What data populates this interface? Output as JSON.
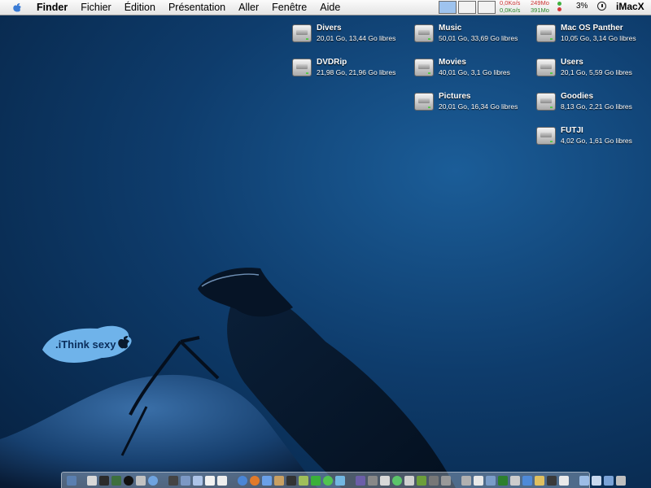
{
  "menubar": {
    "apple_icon": "apple-icon",
    "items": [
      "Finder",
      "Fichier",
      "Édition",
      "Présentation",
      "Aller",
      "Fenêtre",
      "Aide"
    ],
    "net": {
      "up": "0,0Ko/s",
      "down": "0,0Ko/s"
    },
    "mem": {
      "used": "249Mo",
      "free": "391Mo"
    },
    "cpu": "3%",
    "hostname": "iMacX"
  },
  "desktop": {
    "disks": [
      {
        "name": "Divers",
        "info": "20,01 Go, 13,44 Go libres"
      },
      {
        "name": "DVDRip",
        "info": "21,98 Go, 21,96 Go libres"
      },
      {
        "name": "Music",
        "info": "50,01 Go, 33,69 Go libres"
      },
      {
        "name": "Movies",
        "info": "40,01 Go, 3,1 Go libres"
      },
      {
        "name": "Pictures",
        "info": "20,01 Go, 16,34 Go libres"
      },
      {
        "name": "Mac OS Panther",
        "info": "10,05 Go, 3,14 Go libres"
      },
      {
        "name": "Users",
        "info": "20,1 Go, 5,59 Go libres"
      },
      {
        "name": "Goodies",
        "info": "8,13 Go, 2,21 Go libres"
      },
      {
        "name": "FUTJI",
        "info": "4,02 Go, 1,61 Go libres"
      }
    ],
    "wallpaper_text": ".iThink sexy"
  },
  "colors": {
    "desktop_bg": "#0e3c6c",
    "menubar_bg": "#f0f0f0"
  }
}
